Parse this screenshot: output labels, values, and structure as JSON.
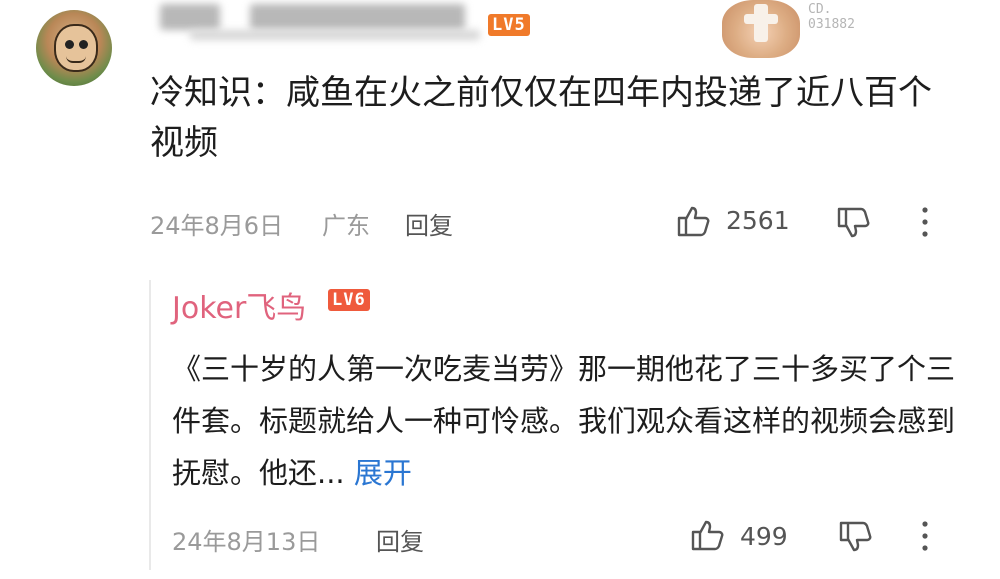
{
  "comment": {
    "level_badge": "LV5",
    "badge_number": "031882",
    "badge_prefix": "CD.",
    "text": "冷知识：咸鱼在火之前仅仅在四年内投递了近八百个视频",
    "date": "24年8月6日",
    "location": "广东",
    "reply_label": "回复",
    "like_count": "2561"
  },
  "reply": {
    "username": "Joker飞鸟",
    "level_badge": "LV6",
    "text": "《三十岁的人第一次吃麦当劳》那一期他花了三十多买了个三件套。标题就给人一种可怜感。我们观众看这样的视频会感到抚慰。他还...",
    "expand_label": "展开",
    "date": "24年8月13日",
    "reply_label": "回复",
    "like_count": "499"
  },
  "icons": [
    "thumbs-up-icon",
    "thumbs-down-icon",
    "more-icon"
  ]
}
